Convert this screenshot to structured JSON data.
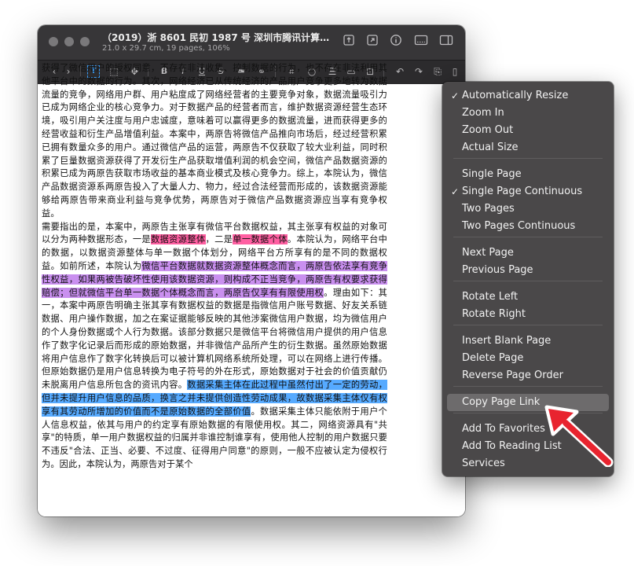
{
  "window": {
    "title": "（2019）浙 8601 民初 1987 号 深圳市腾讯计算机系统有...",
    "subtitle": "21.0 x 29.7 cm, 19 pages, 106%"
  },
  "titlebar_icons": [
    "share-icon",
    "open-external-icon",
    "info-icon",
    "thumbnail-view-icon",
    "sidebar-toggle-icon"
  ],
  "toolbar_icons": [
    "back-icon",
    "forward-icon",
    "text-select-icon",
    "rect-select-icon",
    "move-icon",
    "bold-icon",
    "highlight-icon",
    "underline-icon",
    "strikethrough-icon",
    "redact-icon",
    "link-icon",
    "crop-icon",
    "shape-icon",
    "line-icon",
    "note-icon",
    "textbox-icon",
    "rotate-left-icon",
    "rotate-right-icon",
    "insert-page-icon",
    "delete-page-icon"
  ],
  "document": {
    "p1": "获得了微信用户的授权同意，不存在非法收集、控制数据的行为，也不存在非法利用其他平台中的数据的行为。其次，网络经济已从传统经济的产品用户竞争更多地转为数据流量的竞争，网络用户群、用户粘度成了网络经营者的主要竞争对象，数据流量吸引力已成为网络企业的核心竞争力。对于数据产品的经营者而言，维护数据资源经营生态环境，吸引用户关注度与用户忠诚度，意味着可以赢得更多的数据流量，进而获得更多的经营收益和衍生产品增值利益。本案中，两原告将微信产品推向市场后，经过经营积累已拥有数量众多的用户。通过微信产品的运营，两原告不仅获取了较大业利益，同时积累了巨量数据资源获得了开发衍生产品获取增值利润的机会空间，微信产品数据资源的积累已成为两原告获取市场收益的基本商业模式及核心竞争力。综上，本院认为，微信产品数据资源系两原告投入了大量人力、物力，经过合法经营而形成的，该数据资源能够给两原告带来商业利益与竞争优势，两原告对于微信产品数据资源应当享有竞争权益。",
    "p2_a": "需要指出的是，本案中，两原告主张享有微信平台数据权益，其主张享有权益的对象可以分为两种数据形态，一是",
    "p2_hl1": "数据资源整体",
    "p2_b": "，二是",
    "p2_hl2": "单一数据个体",
    "p2_c": "。本院认为，网络平台中的数据，以数据资源整体与单一数据个体划分，网络平台方所享有的是不同的数据权益。如前所述，本院认为",
    "p2_hl3": "微信平台数据就数据资源整体概念而言，两原告依法享有竞争性权益，如果两被告破坏性使用该数据资源，则构成不正当竞争，两原告有权要求获得赔偿；但就微信平台单一数据个体概念而言，两原告仅享有有限使用权",
    "p2_d": "。理由如下：其一，本案中两原告明确主张其享有数据权益的数据是指微信用户账号数据、好友关系链数据、用户操作数据，加之在案证据能够反映的其他涉案微信用户数据，均为微信用户的个人身份数据或个人行为数据。该部分数据只是微信平台将微信用户提供的用户信息作了数字化记录后而形成的原始数据，并非微信产品所产生的衍生数据。虽然原始数据将用户信息作了数字化转换后可以被计算机网络系统所处理，可以在网络上进行传播。但原始数据仍是用户信息转换为电子符号的外在形式，原始数据对于社会的价值贡献仍未脱离用户信息所包含的资讯内容。",
    "p2_hl4": "数据采集主体在此过程中虽然付出了一定的劳动，但并未提升用户信息的品质，换言之并未提供创造性劳动成果，故数据采集主体仅有权享有其劳动所增加的价值而不是原始数据的全部价值",
    "p2_e": "。数据采集主体只能依附于用户个人信息权益，依其与用户的约定享有原始数据的有限使用权。其二，网络资源具有\"共享\"的特质，单一用户数据权益的归属并非谁控制谁享有，使用他人控制的用户数据只要不违反\"合法、正当、必要、不过度、征得用户同意\"的原则，一般不应被认定为侵权行为。因此，本院认为，两原告对于某个"
  },
  "menu": {
    "items": [
      {
        "label": "Automatically Resize",
        "checked": true
      },
      {
        "label": "Zoom In"
      },
      {
        "label": "Zoom Out"
      },
      {
        "label": "Actual Size"
      },
      {
        "label": "Single Page"
      },
      {
        "label": "Single Page Continuous",
        "checked": true
      },
      {
        "label": "Two Pages"
      },
      {
        "label": "Two Pages Continuous"
      },
      {
        "label": "Next Page"
      },
      {
        "label": "Previous Page"
      },
      {
        "label": "Rotate Left"
      },
      {
        "label": "Rotate Right"
      },
      {
        "label": "Insert Blank Page"
      },
      {
        "label": "Delete Page"
      },
      {
        "label": "Reverse Page Order"
      },
      {
        "label": "Copy Page Link",
        "highlighted": true
      },
      {
        "label": "Add To Favorites"
      },
      {
        "label": "Add To Reading List"
      },
      {
        "label": "Services"
      }
    ],
    "check_mark": "✓"
  },
  "colors": {
    "highlight_pink": "#ff5fa2",
    "highlight_purple": "#c98fef",
    "highlight_blue": "#56aaff",
    "arrow_red": "#e8242f"
  }
}
